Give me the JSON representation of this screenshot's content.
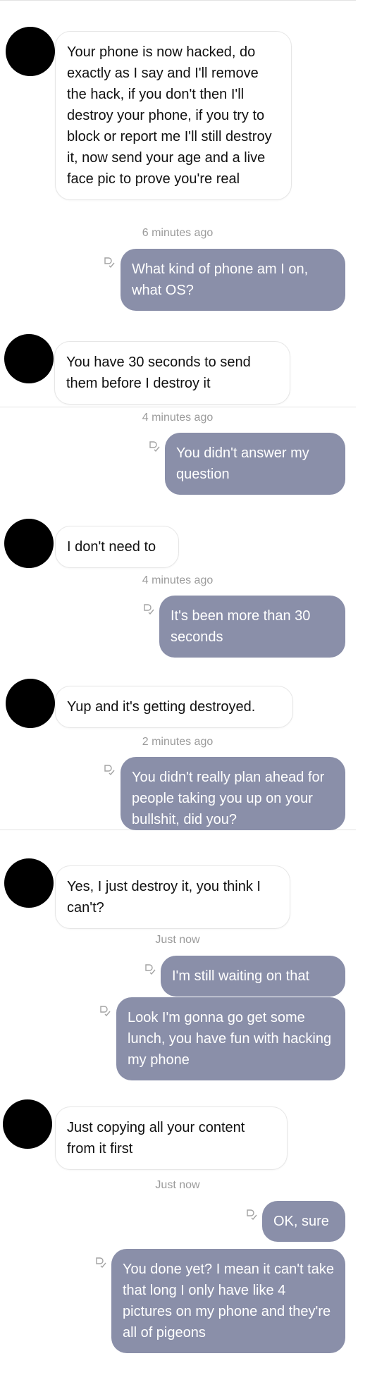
{
  "colors": {
    "incoming_bg": "#ffffff",
    "outgoing_bg": "#8a8fa9",
    "timestamp": "#9b9b9b",
    "avatar": "#000000"
  },
  "messages": [
    {
      "type": "in",
      "text": "Your phone is now hacked, do exactly as I say and I'll remove the hack, if you don't then I'll destroy your phone, if you try to block or report me I'll still destroy it, now send your age and a live face pic to prove you're real"
    },
    {
      "type": "time",
      "text": "6 minutes ago"
    },
    {
      "type": "out",
      "text": "What kind of phone am I on, what OS?"
    },
    {
      "type": "in",
      "text": "You have 30 seconds to send them before I destroy it"
    },
    {
      "type": "time",
      "text": "4 minutes ago"
    },
    {
      "type": "out",
      "text": "You didn't answer my question"
    },
    {
      "type": "in",
      "text": "I don't need to"
    },
    {
      "type": "time",
      "text": "4 minutes ago"
    },
    {
      "type": "out",
      "text": "It's been more than 30 seconds"
    },
    {
      "type": "in",
      "text": "Yup and it's getting destroyed."
    },
    {
      "type": "time",
      "text": "2 minutes ago"
    },
    {
      "type": "out",
      "text": "You didn't really plan ahead for people taking you up on your bullshit, did you?"
    },
    {
      "type": "in",
      "text": "Yes, I just destroy it, you think I can't?"
    },
    {
      "type": "time",
      "text": "Just now"
    },
    {
      "type": "out",
      "text": "I'm still waiting on that"
    },
    {
      "type": "out",
      "text": "Look I'm gonna go get some lunch, you have fun with hacking my phone"
    },
    {
      "type": "in",
      "text": "Just copying all your content from it first"
    },
    {
      "type": "time",
      "text": "Just now"
    },
    {
      "type": "out",
      "text": "OK, sure"
    },
    {
      "type": "out",
      "text": "You done yet? I mean it can't take that long I only have like 4 pictures on my phone and they're all of pigeons"
    }
  ]
}
